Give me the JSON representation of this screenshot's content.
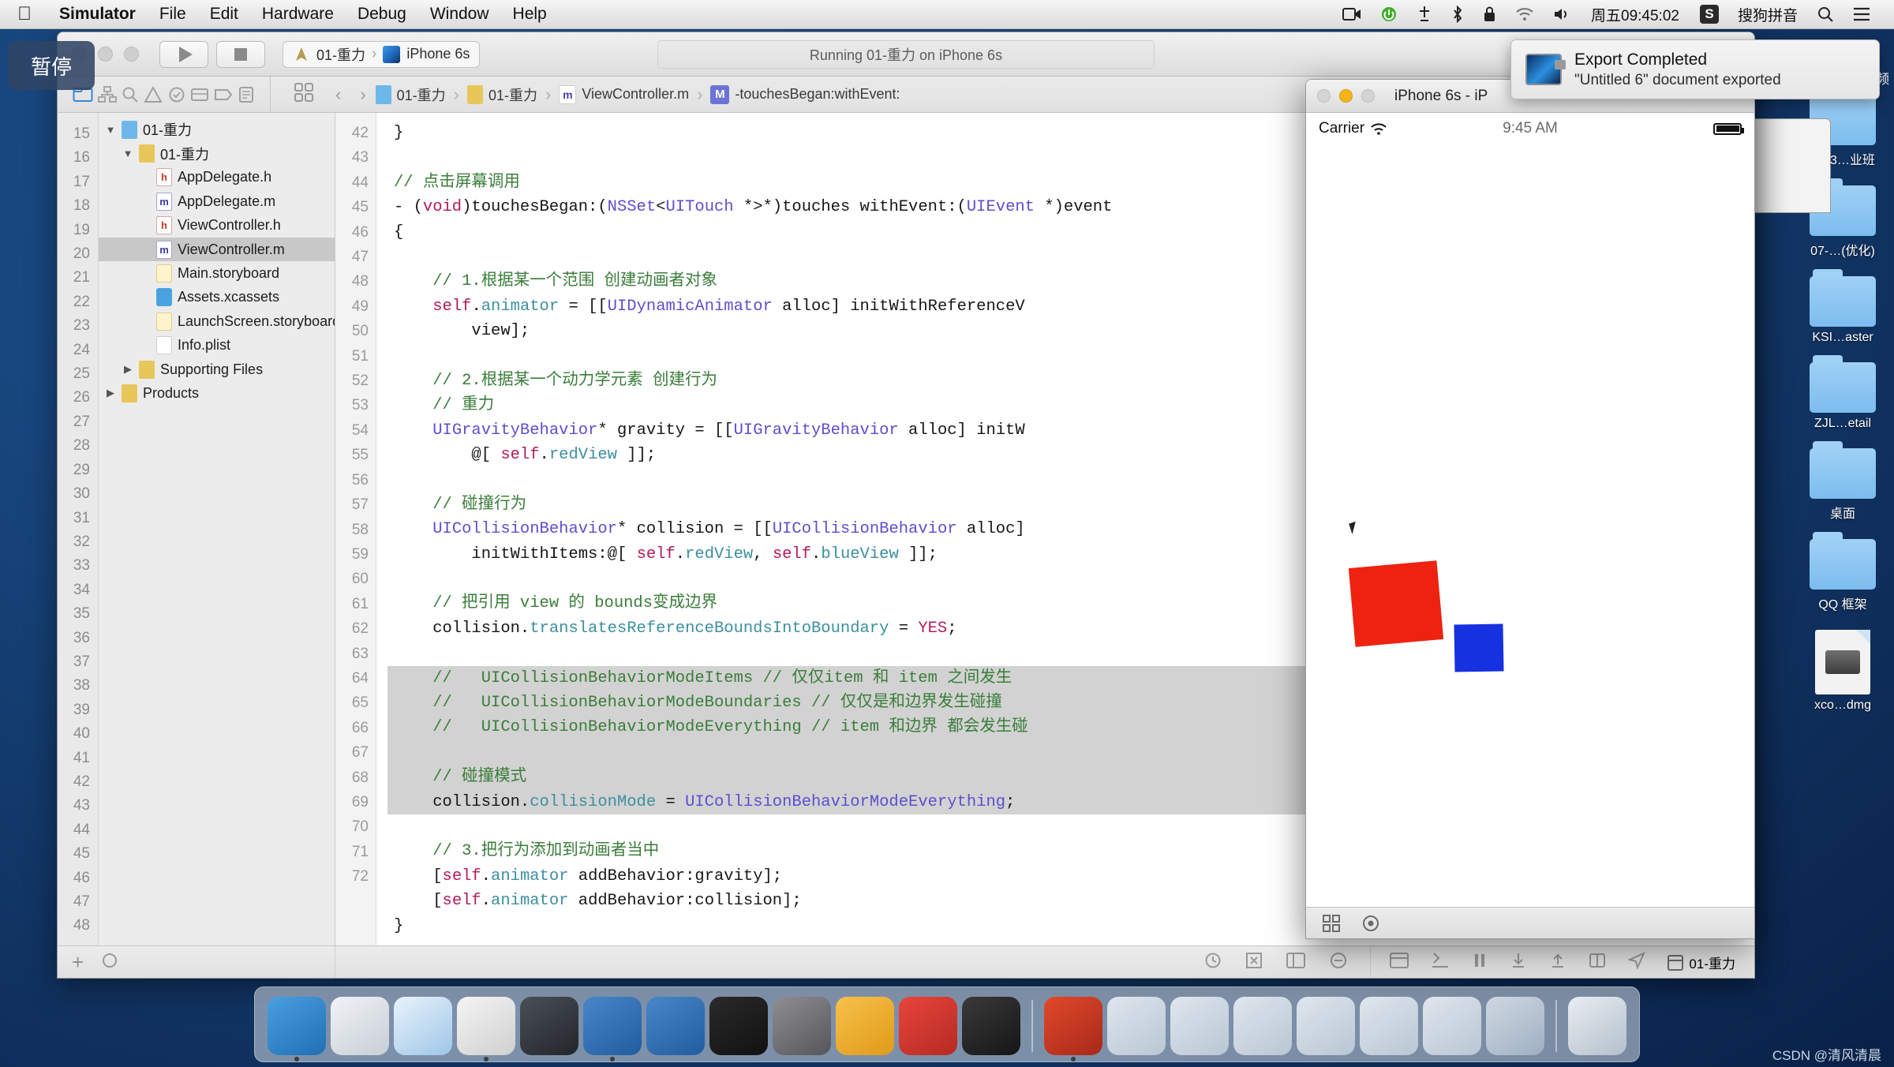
{
  "menubar": {
    "apple_icon": "apple-icon",
    "items": [
      "Simulator",
      "File",
      "Edit",
      "Hardware",
      "Debug",
      "Window",
      "Help"
    ],
    "right": {
      "screen_record_icon": "screen-record-icon",
      "power_icon": "power-icon",
      "airdrop_icon": "airdrop-icon",
      "bluetooth_icon": "bluetooth-icon",
      "lock_icon": "lock-icon",
      "wifi_icon": "wifi-icon",
      "volume_icon": "volume-icon",
      "clock": "周五09:45:02",
      "input_badge": "S",
      "input_method": "搜狗拼音",
      "search_icon": "search-icon",
      "notification_center_icon": "notification-center-icon"
    }
  },
  "pause_overlay": {
    "label": "暂停"
  },
  "notification": {
    "icon": "quicktime-icon",
    "title": "Export Completed",
    "subtitle": "\"Untitled 6\" document exported"
  },
  "xcode": {
    "toolbar": {
      "run_icon": "run-play-icon",
      "stop_icon": "stop-square-icon",
      "scheme_app_icon": "xcode-scheme-icon",
      "scheme_name": "01-重力",
      "scheme_separator": "›",
      "device_icon": "iphone-device-icon",
      "device_name": "iPhone 6s",
      "status": "Running 01-重力 on iPhone 6s"
    },
    "navigator_toolbar": {
      "folder_icon": "folder-navigator-icon",
      "hierarchy_icon": "hierarchy-navigator-icon",
      "search_icon": "search-navigator-icon",
      "warning_icon": "warning-navigator-icon",
      "test_icon": "test-navigator-icon",
      "debug_icon": "debug-navigator-icon",
      "breakpoint_icon": "breakpoint-navigator-icon",
      "report_icon": "report-navigator-icon"
    },
    "jumpbar": {
      "grid_icon": "related-items-icon",
      "back_icon": "back-chevron-icon",
      "forward_icon": "forward-chevron-icon",
      "crumbs": [
        {
          "icon": "project-icon",
          "label": "01-重力"
        },
        {
          "icon": "folder-icon",
          "label": "01-重力"
        },
        {
          "icon": "m-file-icon",
          "label": "ViewController.m"
        },
        {
          "icon": "method-badge-icon",
          "label": "-touchesBegan:withEvent:"
        }
      ]
    },
    "navigator": {
      "items": [
        {
          "label": "01-重力",
          "icon": "project-icon",
          "indent": 0,
          "disclosure": "▼",
          "selected": false
        },
        {
          "label": "01-重力",
          "icon": "folder-icon",
          "indent": 1,
          "disclosure": "▼",
          "selected": false
        },
        {
          "label": "AppDelegate.h",
          "icon": "h-file-icon",
          "indent": 2,
          "disclosure": "",
          "selected": false
        },
        {
          "label": "AppDelegate.m",
          "icon": "m-file-icon",
          "indent": 2,
          "disclosure": "",
          "selected": false
        },
        {
          "label": "ViewController.h",
          "icon": "h-file-icon",
          "indent": 2,
          "disclosure": "",
          "selected": false
        },
        {
          "label": "ViewController.m",
          "icon": "m-file-icon",
          "indent": 2,
          "disclosure": "",
          "selected": true
        },
        {
          "label": "Main.storyboard",
          "icon": "storyboard-icon",
          "indent": 2,
          "disclosure": "",
          "selected": false
        },
        {
          "label": "Assets.xcassets",
          "icon": "xcassets-icon",
          "indent": 2,
          "disclosure": "",
          "selected": false
        },
        {
          "label": "LaunchScreen.storyboard",
          "icon": "storyboard-icon",
          "indent": 2,
          "disclosure": "",
          "selected": false
        },
        {
          "label": "Info.plist",
          "icon": "plist-icon",
          "indent": 2,
          "disclosure": "",
          "selected": false
        },
        {
          "label": "Supporting Files",
          "icon": "folder-icon",
          "indent": 1,
          "disclosure": "▶",
          "selected": false
        },
        {
          "label": "Products",
          "icon": "folder-icon",
          "indent": 0,
          "disclosure": "▶",
          "selected": false
        }
      ]
    },
    "left_line_numbers": [
      15,
      16,
      17,
      18,
      19,
      20,
      21,
      22,
      23,
      24,
      25,
      26,
      27,
      28,
      29,
      30,
      31,
      32,
      33,
      34,
      35,
      36,
      37,
      38,
      39,
      40,
      41,
      42,
      43,
      44,
      45,
      46,
      47,
      48
    ],
    "editor": {
      "first_line": 42,
      "lines": [
        {
          "n": 42,
          "highlight": false,
          "tokens": [
            {
              "t": "}",
              "c": "txt"
            }
          ]
        },
        {
          "n": 43,
          "highlight": false,
          "tokens": []
        },
        {
          "n": 44,
          "highlight": false,
          "tokens": [
            {
              "t": "// 点击屏幕调用",
              "c": "cmt"
            }
          ]
        },
        {
          "n": 45,
          "highlight": false,
          "tokens": [
            {
              "t": "- (",
              "c": "txt"
            },
            {
              "t": "void",
              "c": "kw"
            },
            {
              "t": ")touchesBegan:(",
              "c": "txt"
            },
            {
              "t": "NSSet",
              "c": "ty"
            },
            {
              "t": "<",
              "c": "txt"
            },
            {
              "t": "UITouch",
              "c": "ty"
            },
            {
              "t": " *>*)touches withEvent:(",
              "c": "txt"
            },
            {
              "t": "UIEvent",
              "c": "ty"
            },
            {
              "t": " *)event",
              "c": "txt"
            }
          ]
        },
        {
          "n": 46,
          "highlight": false,
          "tokens": [
            {
              "t": "{",
              "c": "txt"
            }
          ]
        },
        {
          "n": 47,
          "highlight": false,
          "tokens": []
        },
        {
          "n": 48,
          "highlight": false,
          "tokens": [
            {
              "t": "    // 1.根据某一个范围 创建动画者对象",
              "c": "cmt"
            }
          ]
        },
        {
          "n": 49,
          "highlight": false,
          "tokens": [
            {
              "t": "    ",
              "c": "txt"
            },
            {
              "t": "self",
              "c": "self"
            },
            {
              "t": ".",
              "c": "txt"
            },
            {
              "t": "animator",
              "c": "prop"
            },
            {
              "t": " = [[",
              "c": "txt"
            },
            {
              "t": "UIDynamicAnimator",
              "c": "ty"
            },
            {
              "t": " alloc] initWithReferenceV",
              "c": "txt"
            }
          ]
        },
        {
          "n": null,
          "highlight": false,
          "tokens": [
            {
              "t": "        view];",
              "c": "txt"
            }
          ]
        },
        {
          "n": 50,
          "highlight": false,
          "tokens": []
        },
        {
          "n": 51,
          "highlight": false,
          "tokens": [
            {
              "t": "    // 2.根据某一个动力学元素 创建行为",
              "c": "cmt"
            }
          ]
        },
        {
          "n": 52,
          "highlight": false,
          "tokens": [
            {
              "t": "    // 重力",
              "c": "cmt"
            }
          ]
        },
        {
          "n": 53,
          "highlight": false,
          "tokens": [
            {
              "t": "    ",
              "c": "txt"
            },
            {
              "t": "UIGravityBehavior",
              "c": "ty"
            },
            {
              "t": "* gravity = [[",
              "c": "txt"
            },
            {
              "t": "UIGravityBehavior",
              "c": "ty"
            },
            {
              "t": " alloc] initW",
              "c": "txt"
            }
          ]
        },
        {
          "n": null,
          "highlight": false,
          "tokens": [
            {
              "t": "        @[ ",
              "c": "txt"
            },
            {
              "t": "self",
              "c": "self"
            },
            {
              "t": ".",
              "c": "txt"
            },
            {
              "t": "redView",
              "c": "prop"
            },
            {
              "t": " ]];",
              "c": "txt"
            }
          ]
        },
        {
          "n": 54,
          "highlight": false,
          "tokens": []
        },
        {
          "n": 55,
          "highlight": false,
          "tokens": [
            {
              "t": "    // 碰撞行为",
              "c": "cmt"
            }
          ]
        },
        {
          "n": 56,
          "highlight": false,
          "tokens": [
            {
              "t": "    ",
              "c": "txt"
            },
            {
              "t": "UICollisionBehavior",
              "c": "ty"
            },
            {
              "t": "* collision = [[",
              "c": "txt"
            },
            {
              "t": "UICollisionBehavior",
              "c": "ty"
            },
            {
              "t": " alloc]",
              "c": "txt"
            }
          ]
        },
        {
          "n": null,
          "highlight": false,
          "tokens": [
            {
              "t": "        initWithItems:@[ ",
              "c": "txt"
            },
            {
              "t": "self",
              "c": "self"
            },
            {
              "t": ".",
              "c": "txt"
            },
            {
              "t": "redView",
              "c": "prop"
            },
            {
              "t": ", ",
              "c": "txt"
            },
            {
              "t": "self",
              "c": "self"
            },
            {
              "t": ".",
              "c": "txt"
            },
            {
              "t": "blueView",
              "c": "prop"
            },
            {
              "t": " ]];",
              "c": "txt"
            }
          ]
        },
        {
          "n": 57,
          "highlight": false,
          "tokens": []
        },
        {
          "n": 58,
          "highlight": false,
          "tokens": [
            {
              "t": "    // 把引用 view 的 bounds变成边界",
              "c": "cmt"
            }
          ]
        },
        {
          "n": 59,
          "highlight": false,
          "tokens": [
            {
              "t": "    collision.",
              "c": "txt"
            },
            {
              "t": "translatesReferenceBoundsIntoBoundary",
              "c": "prop"
            },
            {
              "t": " = ",
              "c": "txt"
            },
            {
              "t": "YES",
              "c": "kw"
            },
            {
              "t": ";",
              "c": "txt"
            }
          ]
        },
        {
          "n": 60,
          "highlight": false,
          "tokens": []
        },
        {
          "n": 61,
          "highlight": true,
          "tokens": [
            {
              "t": "    //   UICollisionBehaviorModeItems // 仅仅item 和 item 之间发生",
              "c": "cmt"
            }
          ]
        },
        {
          "n": 62,
          "highlight": true,
          "tokens": [
            {
              "t": "    //   UICollisionBehaviorModeBoundaries // 仅仅是和边界发生碰撞",
              "c": "cmt"
            }
          ]
        },
        {
          "n": 63,
          "highlight": true,
          "tokens": [
            {
              "t": "    //   UICollisionBehaviorModeEverything // item 和边界 都会发生碰",
              "c": "cmt"
            }
          ]
        },
        {
          "n": 64,
          "highlight": true,
          "tokens": []
        },
        {
          "n": 65,
          "highlight": true,
          "tokens": [
            {
              "t": "    // 碰撞模式",
              "c": "cmt"
            }
          ]
        },
        {
          "n": 66,
          "highlight": true,
          "tokens": [
            {
              "t": "    collision.",
              "c": "txt"
            },
            {
              "t": "collisionMode",
              "c": "prop"
            },
            {
              "t": " = ",
              "c": "txt"
            },
            {
              "t": "UICollisionBehaviorModeEverything",
              "c": "ty"
            },
            {
              "t": ";",
              "c": "txt"
            }
          ]
        },
        {
          "n": 67,
          "highlight": false,
          "tokens": []
        },
        {
          "n": 68,
          "highlight": false,
          "tokens": [
            {
              "t": "    // 3.把行为添加到动画者当中",
              "c": "cmt"
            }
          ]
        },
        {
          "n": 69,
          "highlight": false,
          "tokens": [
            {
              "t": "    [",
              "c": "txt"
            },
            {
              "t": "self",
              "c": "self"
            },
            {
              "t": ".",
              "c": "txt"
            },
            {
              "t": "animator",
              "c": "prop"
            },
            {
              "t": " addBehavior:gravity];",
              "c": "txt"
            }
          ]
        },
        {
          "n": 70,
          "highlight": false,
          "tokens": [
            {
              "t": "    [",
              "c": "txt"
            },
            {
              "t": "self",
              "c": "self"
            },
            {
              "t": ".",
              "c": "txt"
            },
            {
              "t": "animator",
              "c": "prop"
            },
            {
              "t": " addBehavior:collision];",
              "c": "txt"
            }
          ]
        },
        {
          "n": 71,
          "highlight": false,
          "tokens": [
            {
              "t": "}",
              "c": "txt"
            }
          ]
        },
        {
          "n": 72,
          "highlight": false,
          "tokens": []
        }
      ]
    },
    "bottom_bar": {
      "add_icon": "add-icon",
      "filter_icon": "filter-icon",
      "clock_icon": "clock-icon",
      "close_icon": "close-icon",
      "console_icon": "console-icon",
      "step_over_icon": "step-over-icon",
      "pause_icon": "pause-icon",
      "step_into_icon": "step-into-icon",
      "step_out_icon": "step-out-icon",
      "stack_icon": "stack-icon",
      "location_icon": "location-icon",
      "thread_icon": "thread-icon",
      "thread_label": "01-重力",
      "split_icon": "split-view-icon",
      "minus_icon": "collapse-icon"
    }
  },
  "simulator": {
    "title": "iPhone 6s - iP",
    "statusbar": {
      "carrier": "Carrier",
      "wifi_icon": "wifi-icon",
      "time": "9:45 AM",
      "battery_icon": "battery-icon"
    },
    "views": [
      {
        "name": "redView",
        "color": "#ee2211"
      },
      {
        "name": "blueView",
        "color": "#1631e0"
      }
    ],
    "bottom": {
      "grid_icon": "grid-icon",
      "record_icon": "record-icon"
    }
  },
  "desktop": {
    "top_label": "未…视频",
    "icons": [
      {
        "type": "folder",
        "label": "第13…业班"
      },
      {
        "type": "folder",
        "label": "07-…(优化)"
      },
      {
        "type": "folder",
        "label": "KSI…aster"
      },
      {
        "type": "folder",
        "label": "ZJL…etail"
      },
      {
        "type": "folder",
        "label": "桌面"
      },
      {
        "type": "folder",
        "label": "QQ 框架"
      },
      {
        "type": "dmg",
        "label": "xco…dmg"
      }
    ]
  },
  "dock": {
    "apps": [
      {
        "name": "finder",
        "color1": "#4a9fe0",
        "color2": "#1f6fb5",
        "running": true
      },
      {
        "name": "launchpad",
        "color1": "#f0f3f6",
        "color2": "#c8ced6",
        "running": false
      },
      {
        "name": "safari",
        "color1": "#e8f3fb",
        "color2": "#9fc6e8",
        "running": false
      },
      {
        "name": "simulator",
        "color1": "#f4f4f4",
        "color2": "#d0d0d0",
        "running": true
      },
      {
        "name": "imovie",
        "color1": "#4a4f57",
        "color2": "#23262b",
        "running": false
      },
      {
        "name": "xcode",
        "color1": "#4a86c8",
        "color2": "#1f5d9e",
        "running": true
      },
      {
        "name": "xcode-beta",
        "color1": "#4a86c8",
        "color2": "#1f5d9e",
        "running": false
      },
      {
        "name": "terminal",
        "color1": "#2a2a2a",
        "color2": "#111111",
        "running": false
      },
      {
        "name": "system-preferences",
        "color1": "#8e8e93",
        "color2": "#55555a",
        "running": false
      },
      {
        "name": "sketch",
        "color1": "#f7c14b",
        "color2": "#e09a18",
        "running": false
      },
      {
        "name": "paw",
        "color1": "#e8453c",
        "color2": "#b52a23",
        "running": false
      },
      {
        "name": "exec",
        "color1": "#3a3a3a",
        "color2": "#151515",
        "running": false
      },
      {
        "name": "media-player",
        "color1": "#e04a2a",
        "color2": "#a8281a",
        "running": true
      },
      {
        "name": "finder-window-1",
        "color1": "#dfe6ee",
        "color2": "#b9c6d4",
        "running": false
      },
      {
        "name": "finder-window-2",
        "color1": "#dfe6ee",
        "color2": "#b9c6d4",
        "running": false
      },
      {
        "name": "finder-window-3",
        "color1": "#dfe6ee",
        "color2": "#b9c6d4",
        "running": false
      },
      {
        "name": "finder-window-4",
        "color1": "#dfe6ee",
        "color2": "#b9c6d4",
        "running": false
      },
      {
        "name": "finder-window-5",
        "color1": "#dfe6ee",
        "color2": "#b9c6d4",
        "running": false
      },
      {
        "name": "finder-window-6",
        "color1": "#dfe6ee",
        "color2": "#b9c6d4",
        "running": false
      },
      {
        "name": "downloads-stack",
        "color1": "#cfd8e2",
        "color2": "#9fb0c2",
        "running": false
      },
      {
        "name": "trash",
        "color1": "#e8edf2",
        "color2": "#b4c0cc",
        "running": false
      }
    ]
  },
  "watermark": "CSDN @清风清晨"
}
